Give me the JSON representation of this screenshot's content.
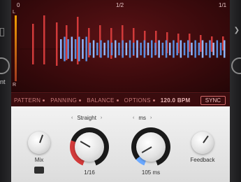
{
  "ruler": {
    "start": "0",
    "half": "1/2",
    "end": "1/1"
  },
  "channels": {
    "left": "L",
    "right": "R"
  },
  "options": {
    "pattern": "PATTERN",
    "panning": "PANNING",
    "balance": "BALANCE",
    "options": "OPTIONS",
    "bpm": "120.0 BPM",
    "sync": "SYNC"
  },
  "controls": {
    "mode_selector": "Straight",
    "unit_selector": "ms",
    "mix_label": "Mix",
    "knob1_value": "1/16",
    "knob2_value": "105 ms",
    "feedback_label": "Feedback"
  },
  "host": {
    "partial_label": "nt"
  },
  "colors": {
    "accent_red": "#d23a3a",
    "accent_blue": "#6aa8ff",
    "display_bg": "#3a0a0c",
    "panel_bg": "#e9e9e9"
  }
}
